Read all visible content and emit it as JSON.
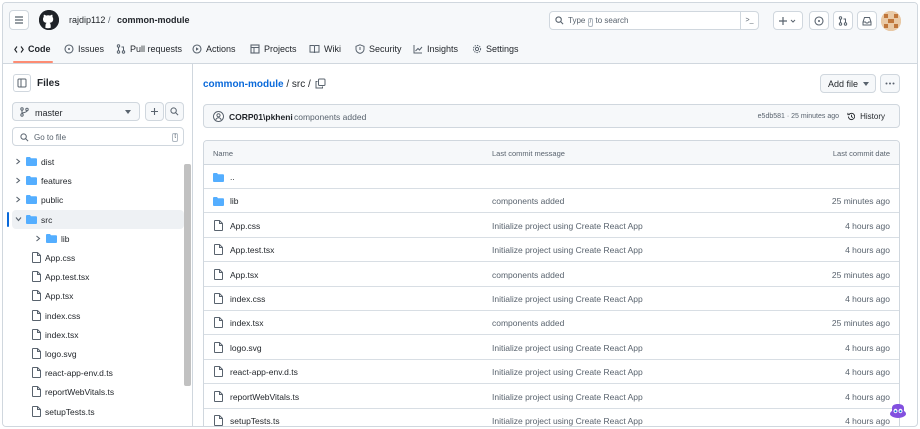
{
  "header": {
    "owner": "rajdip112",
    "separator": "/",
    "repo": "common-module",
    "search_placeholder": "Type",
    "search_key": "/",
    "search_suffix": "to search",
    "command_key": ">_"
  },
  "tabs": [
    {
      "label": "Code",
      "icon": "code-icon"
    },
    {
      "label": "Issues",
      "icon": "issue-icon"
    },
    {
      "label": "Pull requests",
      "icon": "pull-request-icon"
    },
    {
      "label": "Actions",
      "icon": "play-icon"
    },
    {
      "label": "Projects",
      "icon": "table-icon"
    },
    {
      "label": "Wiki",
      "icon": "book-icon"
    },
    {
      "label": "Security",
      "icon": "shield-icon"
    },
    {
      "label": "Insights",
      "icon": "graph-icon"
    },
    {
      "label": "Settings",
      "icon": "gear-icon"
    }
  ],
  "sidebar": {
    "title": "Files",
    "branch": "master",
    "goto_placeholder": "Go to file",
    "goto_key": "t",
    "tree": [
      {
        "label": "dist",
        "type": "folder",
        "depth": 0,
        "expanded": false,
        "selected": false
      },
      {
        "label": "features",
        "type": "folder",
        "depth": 0,
        "expanded": false,
        "selected": false
      },
      {
        "label": "public",
        "type": "folder",
        "depth": 0,
        "expanded": false,
        "selected": false
      },
      {
        "label": "src",
        "type": "folder",
        "depth": 0,
        "expanded": true,
        "selected": true
      },
      {
        "label": "lib",
        "type": "folder",
        "depth": 1,
        "expanded": false,
        "selected": false
      },
      {
        "label": "App.css",
        "type": "file",
        "depth": 1,
        "selected": false
      },
      {
        "label": "App.test.tsx",
        "type": "file",
        "depth": 1,
        "selected": false
      },
      {
        "label": "App.tsx",
        "type": "file",
        "depth": 1,
        "selected": false
      },
      {
        "label": "index.css",
        "type": "file",
        "depth": 1,
        "selected": false
      },
      {
        "label": "index.tsx",
        "type": "file",
        "depth": 1,
        "selected": false
      },
      {
        "label": "logo.svg",
        "type": "file",
        "depth": 1,
        "selected": false
      },
      {
        "label": "react-app-env.d.ts",
        "type": "file",
        "depth": 1,
        "selected": false
      },
      {
        "label": "reportWebVitals.ts",
        "type": "file",
        "depth": 1,
        "selected": false
      },
      {
        "label": "setupTests.ts",
        "type": "file",
        "depth": 1,
        "selected": false
      }
    ]
  },
  "main": {
    "breadcrumb_repo": "common-module",
    "breadcrumb_path": "/ src /",
    "add_file_label": "Add file",
    "commit": {
      "author": "CORP01\\pkheni",
      "message": "components added",
      "hash_time": "e5db581 · 25 minutes ago",
      "history_label": "History"
    },
    "table": {
      "headers": [
        "Name",
        "Last commit message",
        "Last commit date"
      ],
      "rows": [
        {
          "name": "..",
          "type": "folder",
          "message": "",
          "date": ""
        },
        {
          "name": "lib",
          "type": "folder",
          "message": "components added",
          "date": "25 minutes ago"
        },
        {
          "name": "App.css",
          "type": "file",
          "message": "Initialize project using Create React App",
          "date": "4 hours ago"
        },
        {
          "name": "App.test.tsx",
          "type": "file",
          "message": "Initialize project using Create React App",
          "date": "4 hours ago"
        },
        {
          "name": "App.tsx",
          "type": "file",
          "message": "components added",
          "date": "25 minutes ago"
        },
        {
          "name": "index.css",
          "type": "file",
          "message": "Initialize project using Create React App",
          "date": "4 hours ago"
        },
        {
          "name": "index.tsx",
          "type": "file",
          "message": "components added",
          "date": "25 minutes ago"
        },
        {
          "name": "logo.svg",
          "type": "file",
          "message": "Initialize project using Create React App",
          "date": "4 hours ago"
        },
        {
          "name": "react-app-env.d.ts",
          "type": "file",
          "message": "Initialize project using Create React App",
          "date": "4 hours ago"
        },
        {
          "name": "reportWebVitals.ts",
          "type": "file",
          "message": "Initialize project using Create React App",
          "date": "4 hours ago"
        },
        {
          "name": "setupTests.ts",
          "type": "file",
          "message": "Initialize project using Create React App",
          "date": "4 hours ago"
        }
      ]
    }
  },
  "colors": {
    "link": "#0969da",
    "folder": "#54aeff",
    "tab_underline": "#fd8c73",
    "muted": "#59636e",
    "border": "#d0d7de"
  }
}
